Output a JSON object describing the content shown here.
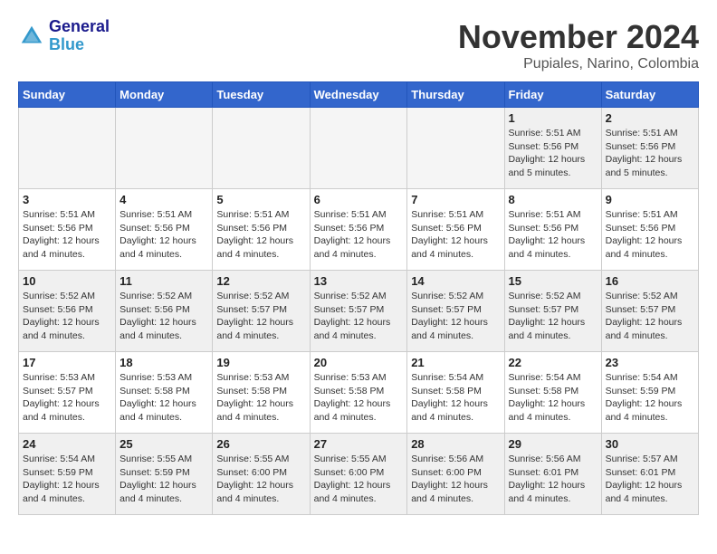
{
  "header": {
    "logo_general": "General",
    "logo_blue": "Blue",
    "month_title": "November 2024",
    "location": "Pupiales, Narino, Colombia"
  },
  "weekdays": [
    "Sunday",
    "Monday",
    "Tuesday",
    "Wednesday",
    "Thursday",
    "Friday",
    "Saturday"
  ],
  "weeks": [
    [
      {
        "day": "",
        "info": ""
      },
      {
        "day": "",
        "info": ""
      },
      {
        "day": "",
        "info": ""
      },
      {
        "day": "",
        "info": ""
      },
      {
        "day": "",
        "info": ""
      },
      {
        "day": "1",
        "info": "Sunrise: 5:51 AM\nSunset: 5:56 PM\nDaylight: 12 hours\nand 5 minutes."
      },
      {
        "day": "2",
        "info": "Sunrise: 5:51 AM\nSunset: 5:56 PM\nDaylight: 12 hours\nand 5 minutes."
      }
    ],
    [
      {
        "day": "3",
        "info": "Sunrise: 5:51 AM\nSunset: 5:56 PM\nDaylight: 12 hours\nand 4 minutes."
      },
      {
        "day": "4",
        "info": "Sunrise: 5:51 AM\nSunset: 5:56 PM\nDaylight: 12 hours\nand 4 minutes."
      },
      {
        "day": "5",
        "info": "Sunrise: 5:51 AM\nSunset: 5:56 PM\nDaylight: 12 hours\nand 4 minutes."
      },
      {
        "day": "6",
        "info": "Sunrise: 5:51 AM\nSunset: 5:56 PM\nDaylight: 12 hours\nand 4 minutes."
      },
      {
        "day": "7",
        "info": "Sunrise: 5:51 AM\nSunset: 5:56 PM\nDaylight: 12 hours\nand 4 minutes."
      },
      {
        "day": "8",
        "info": "Sunrise: 5:51 AM\nSunset: 5:56 PM\nDaylight: 12 hours\nand 4 minutes."
      },
      {
        "day": "9",
        "info": "Sunrise: 5:51 AM\nSunset: 5:56 PM\nDaylight: 12 hours\nand 4 minutes."
      }
    ],
    [
      {
        "day": "10",
        "info": "Sunrise: 5:52 AM\nSunset: 5:56 PM\nDaylight: 12 hours\nand 4 minutes."
      },
      {
        "day": "11",
        "info": "Sunrise: 5:52 AM\nSunset: 5:56 PM\nDaylight: 12 hours\nand 4 minutes."
      },
      {
        "day": "12",
        "info": "Sunrise: 5:52 AM\nSunset: 5:57 PM\nDaylight: 12 hours\nand 4 minutes."
      },
      {
        "day": "13",
        "info": "Sunrise: 5:52 AM\nSunset: 5:57 PM\nDaylight: 12 hours\nand 4 minutes."
      },
      {
        "day": "14",
        "info": "Sunrise: 5:52 AM\nSunset: 5:57 PM\nDaylight: 12 hours\nand 4 minutes."
      },
      {
        "day": "15",
        "info": "Sunrise: 5:52 AM\nSunset: 5:57 PM\nDaylight: 12 hours\nand 4 minutes."
      },
      {
        "day": "16",
        "info": "Sunrise: 5:52 AM\nSunset: 5:57 PM\nDaylight: 12 hours\nand 4 minutes."
      }
    ],
    [
      {
        "day": "17",
        "info": "Sunrise: 5:53 AM\nSunset: 5:57 PM\nDaylight: 12 hours\nand 4 minutes."
      },
      {
        "day": "18",
        "info": "Sunrise: 5:53 AM\nSunset: 5:58 PM\nDaylight: 12 hours\nand 4 minutes."
      },
      {
        "day": "19",
        "info": "Sunrise: 5:53 AM\nSunset: 5:58 PM\nDaylight: 12 hours\nand 4 minutes."
      },
      {
        "day": "20",
        "info": "Sunrise: 5:53 AM\nSunset: 5:58 PM\nDaylight: 12 hours\nand 4 minutes."
      },
      {
        "day": "21",
        "info": "Sunrise: 5:54 AM\nSunset: 5:58 PM\nDaylight: 12 hours\nand 4 minutes."
      },
      {
        "day": "22",
        "info": "Sunrise: 5:54 AM\nSunset: 5:58 PM\nDaylight: 12 hours\nand 4 minutes."
      },
      {
        "day": "23",
        "info": "Sunrise: 5:54 AM\nSunset: 5:59 PM\nDaylight: 12 hours\nand 4 minutes."
      }
    ],
    [
      {
        "day": "24",
        "info": "Sunrise: 5:54 AM\nSunset: 5:59 PM\nDaylight: 12 hours\nand 4 minutes."
      },
      {
        "day": "25",
        "info": "Sunrise: 5:55 AM\nSunset: 5:59 PM\nDaylight: 12 hours\nand 4 minutes."
      },
      {
        "day": "26",
        "info": "Sunrise: 5:55 AM\nSunset: 6:00 PM\nDaylight: 12 hours\nand 4 minutes."
      },
      {
        "day": "27",
        "info": "Sunrise: 5:55 AM\nSunset: 6:00 PM\nDaylight: 12 hours\nand 4 minutes."
      },
      {
        "day": "28",
        "info": "Sunrise: 5:56 AM\nSunset: 6:00 PM\nDaylight: 12 hours\nand 4 minutes."
      },
      {
        "day": "29",
        "info": "Sunrise: 5:56 AM\nSunset: 6:01 PM\nDaylight: 12 hours\nand 4 minutes."
      },
      {
        "day": "30",
        "info": "Sunrise: 5:57 AM\nSunset: 6:01 PM\nDaylight: 12 hours\nand 4 minutes."
      }
    ]
  ]
}
